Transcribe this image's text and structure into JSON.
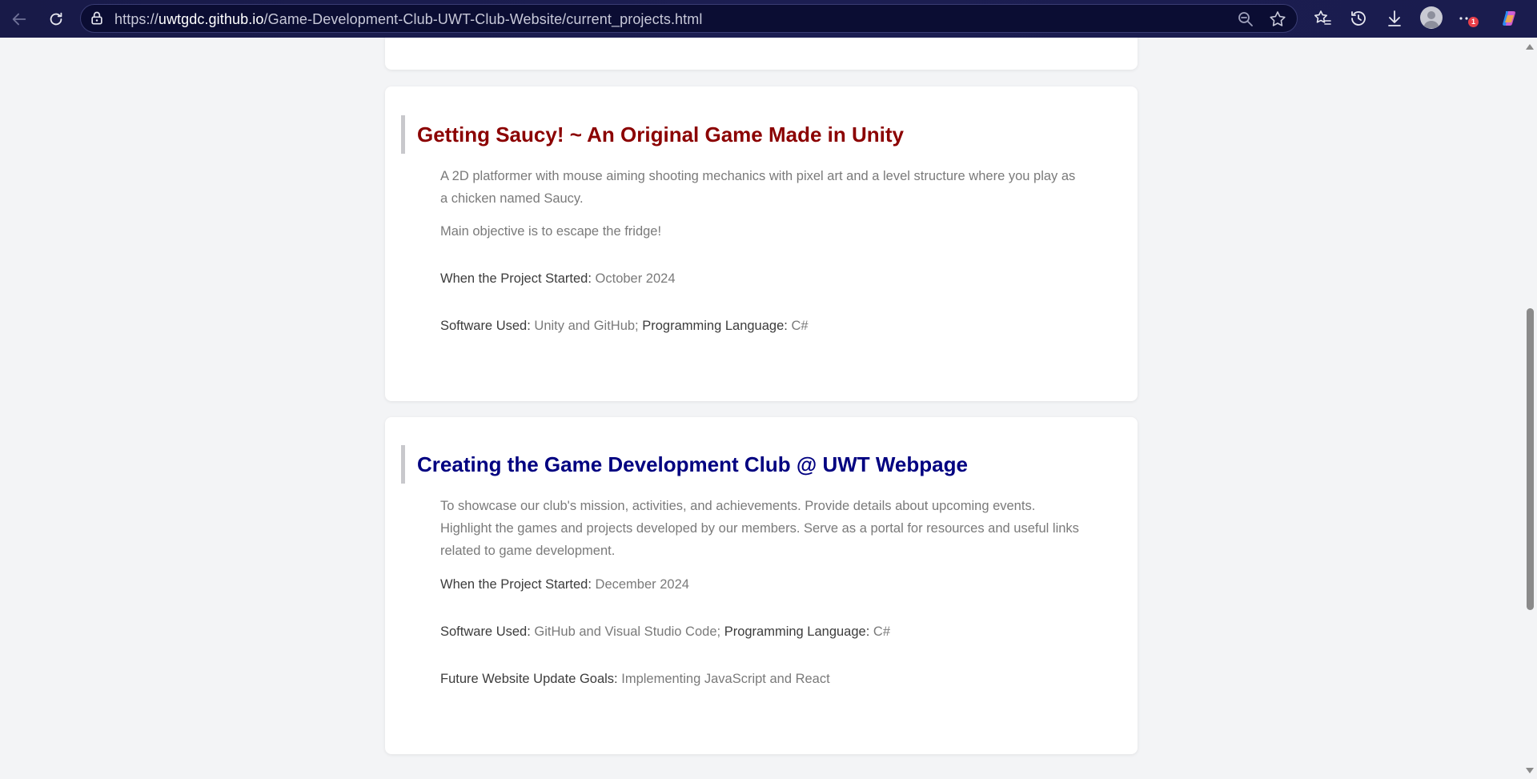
{
  "browser": {
    "url_prefix": "https://",
    "url_host": "uwtgdc.github.io",
    "url_path": "/Game-Development-Club-UWT-Club-Website/current_projects.html",
    "notification_count": "1"
  },
  "projects": [
    {
      "title": "Getting Saucy! ~ An Original Game Made in Unity",
      "title_color": "#8b0000",
      "description": "A 2D platformer with mouse aiming shooting mechanics with pixel art and a level structure where you play as a chicken named Saucy.",
      "objective": "Main objective is to escape the fridge!",
      "started_label": "When the Project Started:",
      "started_value": "October 2024",
      "software_label": "Software Used:",
      "software_value": "Unity and GitHub;",
      "language_label": "Programming Language:",
      "language_value": "C#"
    },
    {
      "title": "Creating the Game Development Club @ UWT Webpage",
      "title_color": "#000080",
      "description": "To showcase our club's mission, activities, and achievements. Provide details about upcoming events. Highlight the games and projects developed by our members. Serve as a portal for resources and useful links related to game development.",
      "started_label": "When the Project Started:",
      "started_value": "December 2024",
      "software_label": "Software Used:",
      "software_value": "GitHub and Visual Studio Code;",
      "language_label": "Programming Language:",
      "language_value": "C#",
      "goals_label": "Future Website Update Goals:",
      "goals_value": "Implementing JavaScript and React"
    }
  ]
}
